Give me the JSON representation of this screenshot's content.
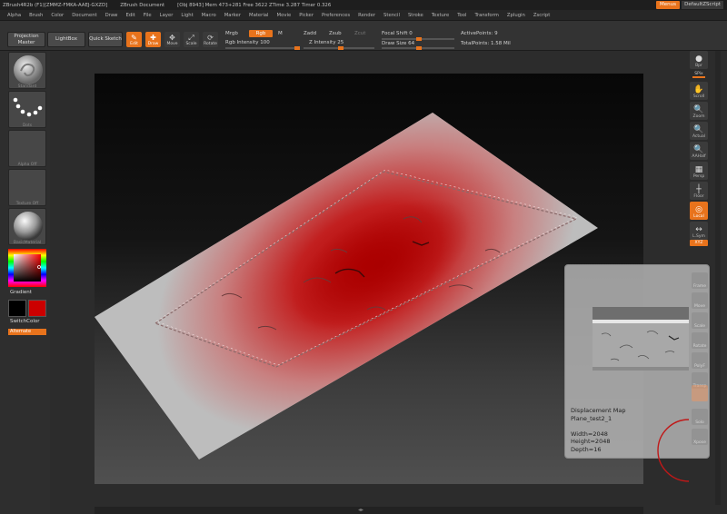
{
  "titlebar": {
    "app": "ZBrush4R2b (F1)[ZMMZ-FMKA-AAEJ-GXZD]",
    "doc": "ZBrush Document",
    "stats": "[Obj 8943] Mem 473+281 Free 3622 ZTime 3.287 Timer 0.326",
    "menus_label": "Menus",
    "script_label": "DefaultZScript"
  },
  "menubar": [
    "Alpha",
    "Brush",
    "Color",
    "Document",
    "Draw",
    "Edit",
    "File",
    "Layer",
    "Light",
    "Macro",
    "Marker",
    "Material",
    "Movie",
    "Picker",
    "Preferences",
    "Render",
    "Stencil",
    "Stroke",
    "Texture",
    "Tool",
    "Transform",
    "Zplugin",
    "Zscript"
  ],
  "shelf": {
    "projection_master": "Projection Master",
    "lightbox": "LightBox",
    "quick_sketch": "Quick Sketch",
    "modes": [
      {
        "label": "Edit",
        "glyph": "✎",
        "active": true
      },
      {
        "label": "Draw",
        "glyph": "✚",
        "active": true
      },
      {
        "label": "Move",
        "glyph": "✥",
        "active": false
      },
      {
        "label": "Scale",
        "glyph": "⤢",
        "active": false
      },
      {
        "label": "Rotate",
        "glyph": "⟳",
        "active": false
      }
    ],
    "mrgb": "Mrgb",
    "rgb": "Rgb",
    "m": "M",
    "rgb_intensity": "Rgb Intensity 100",
    "zadd": "Zadd",
    "zsub": "Zsub",
    "zcut": "Zcut",
    "z_intensity": "Z Intensity 25",
    "focal_shift": "Focal Shift 0",
    "draw_size": "Draw Size 64",
    "active_points": "ActivePoints: 9",
    "total_points": "TotalPoints: 1.58 Mil"
  },
  "leftpanel": {
    "brush_caption": "Standard",
    "stroke_caption": "Dots",
    "alpha_caption": "Alpha Off",
    "texture_caption": "Texture Off",
    "material_caption": "BasicMaterial",
    "gradient": "Gradient",
    "switch_color": "SwitchColor",
    "alternate": "Alternate"
  },
  "rightbar": {
    "items": [
      {
        "label": "Bpr",
        "glyph": "●"
      },
      {
        "label": "SPix",
        "glyph": ""
      },
      {
        "label": "Scroll",
        "glyph": "✋"
      },
      {
        "label": "Zoom",
        "glyph": "🔍"
      },
      {
        "label": "Actual",
        "glyph": "🔍"
      },
      {
        "label": "AAHalf",
        "glyph": "🔍"
      },
      {
        "label": "Persp",
        "glyph": "▦"
      },
      {
        "label": "Floor",
        "glyph": "┼"
      },
      {
        "label": "Local",
        "glyph": "◎"
      },
      {
        "label": "L.Sym",
        "glyph": "↔"
      },
      {
        "label": "XYZ",
        "glyph": ""
      }
    ]
  },
  "popup": {
    "info": "Displacement Map\nPlane_test2_1\n\nWidth=2048\nHeight=2048\nDepth=16",
    "ghosts": [
      "Frame",
      "Move",
      "Scale",
      "Rotate",
      "PolyF",
      "Transp",
      "",
      "Solo",
      "Xpose"
    ]
  },
  "colors": {
    "accent": "#e8731c",
    "primary_color": "#000000",
    "secondary_color": "#cc0000"
  }
}
